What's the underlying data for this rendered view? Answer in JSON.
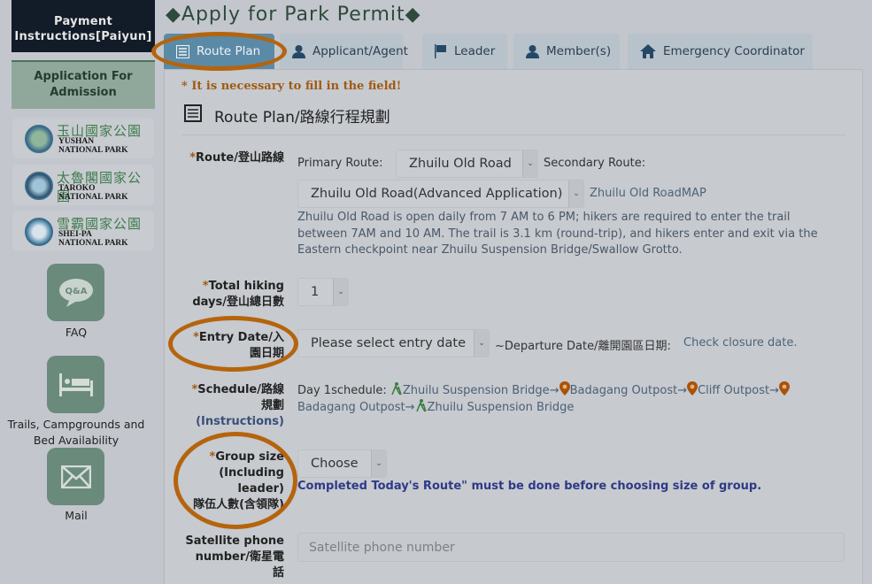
{
  "sidebar": {
    "payment_instructions": "Payment Instructions[Paiyun]",
    "application_for_admission": "Application For Admission",
    "parks": [
      {
        "cn": "玉山國家公園",
        "en1": "YUSHAN",
        "en2": "NATIONAL PARK",
        "icon": "yushan-logo"
      },
      {
        "cn": "太魯閣國家公園",
        "en1": "TAROKO",
        "en2": "NATIONAL PARK",
        "icon": "taroko-logo"
      },
      {
        "cn": "雪霸國家公園",
        "en1": "SHEI-PA",
        "en2": "NATIONAL PARK",
        "icon": "sheipa-logo"
      }
    ],
    "faq_label": "FAQ",
    "faq_icon_text": "Q&A",
    "trails_label": "Trails, Campgrounds and Bed Availability",
    "mail_label": "Mail"
  },
  "page": {
    "title": "◆Apply for Park Permit◆"
  },
  "tabs": [
    {
      "label": "Route Plan",
      "icon": "list-icon",
      "active": true
    },
    {
      "label": "Applicant/Agent",
      "icon": "user-icon",
      "active": false
    },
    {
      "label": "Leader",
      "icon": "flag-icon",
      "active": false
    },
    {
      "label": "Member(s)",
      "icon": "user-icon",
      "active": false
    },
    {
      "label": "Emergency Coordinator",
      "icon": "home-icon",
      "active": false
    }
  ],
  "form": {
    "required_note": "* It is necessary to fill in the field!",
    "section_title": "Route Plan/路線行程規劃",
    "route": {
      "label": "Route/登山路線",
      "primary_label": "Primary Route:",
      "primary_value": "Zhuilu Old Road",
      "secondary_label": "Secondary Route:",
      "secondary_value": "Zhuilu Old Road(Advanced Application)",
      "map_link": "Zhuilu Old RoadMAP",
      "description": "Zhuilu Old Road is open daily from 7 AM to 6 PM; hikers are required to enter the trail between 7AM and 10 AM. The trail is 3.1 km (round-trip), and hikers enter and exit via the Eastern checkpoint near Zhuilu Suspension Bridge/Swallow Grotto."
    },
    "days": {
      "label_line1": "Total hiking",
      "label_line2": "days/登山總日數",
      "value": "1"
    },
    "entry": {
      "label_line1": "Entry Date/入",
      "label_line2": "園日期",
      "placeholder": "Please select entry date",
      "departure_label": "~Departure Date/離開園區日期:",
      "closure_link": "Check closure date."
    },
    "schedule": {
      "label_line1": "Schedule/路線",
      "label_line2": "規劃",
      "instructions": "(Instructions)",
      "day_label": "Day 1schedule:",
      "stops": [
        "Zhuilu Suspension Bridge",
        "Badagang Outpost",
        "Cliff Outpost",
        "Badagang Outpost",
        "Zhuilu Suspension Bridge"
      ],
      "arrow": "→"
    },
    "group": {
      "label_line1": "Group size",
      "label_line2": "(Including",
      "label_line3": "leader)",
      "label_line4": "隊伍人數(含領隊)",
      "value": "Choose",
      "warning": "Completed Today's Route\" must be done before choosing size of group."
    },
    "satellite": {
      "label_line1": "Satellite phone",
      "label_line2": "number/衛星電",
      "label_line3": "話",
      "placeholder": "Satellite phone number"
    },
    "star": "*"
  },
  "colors": {
    "accent_orange": "#b5640d",
    "active_tab": "#5b8aa6",
    "sidebar_dark": "#121b28",
    "sidebar_green": "#8fa89b",
    "icon_green": "#6a8a7c"
  }
}
